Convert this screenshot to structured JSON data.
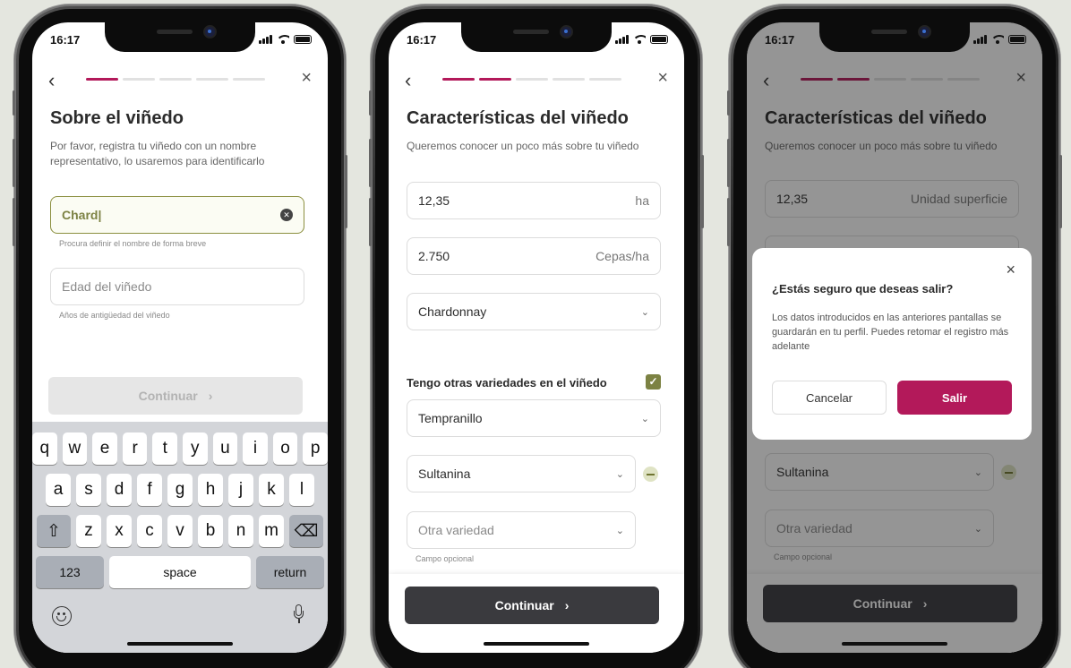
{
  "status": {
    "time": "16:17"
  },
  "screen1": {
    "title": "Sobre el viñedo",
    "subtitle": "Por favor, registra tu viñedo con un nombre representativo, lo usaremos para identificarlo",
    "name_value": "Chard|",
    "name_help": "Procura definir el nombre de forma breve",
    "age_placeholder": "Edad del viñedo",
    "age_help": "Años de antigüedad del viñedo",
    "continue_label": "Continuar",
    "progress_step": 1,
    "keyboard": {
      "row1": [
        "q",
        "w",
        "e",
        "r",
        "t",
        "y",
        "u",
        "i",
        "o",
        "p"
      ],
      "row2": [
        "a",
        "s",
        "d",
        "f",
        "g",
        "h",
        "j",
        "k",
        "l"
      ],
      "row3": [
        "z",
        "x",
        "c",
        "v",
        "b",
        "n",
        "m"
      ],
      "numbers": "123",
      "space": "space",
      "return": "return"
    }
  },
  "screen2": {
    "title": "Características del viñedo",
    "subtitle": "Queremos conocer un poco más sobre tu viñedo",
    "surface_value": "12,35",
    "surface_unit": "ha",
    "density_value": "2.750",
    "density_unit": "Cepas/ha",
    "variety": "Chardonnay",
    "other_varieties_label": "Tengo otras variedades en el viñedo",
    "variety2": "Tempranillo",
    "variety3": "Sultanina",
    "variety4_placeholder": "Otra variedad",
    "optional_help": "Campo opcional",
    "continue_label": "Continuar",
    "progress_step": 2
  },
  "screen3": {
    "title": "Características del viñedo",
    "subtitle": "Queremos conocer un poco más sobre tu viñedo",
    "surface_value": "12,35",
    "surface_unit": "Unidad superficie",
    "variety3": "Sultanina",
    "variety4_placeholder": "Otra variedad",
    "optional_help": "Campo opcional",
    "continue_label": "Continuar",
    "modal": {
      "title": "¿Estás seguro que deseas salir?",
      "body": "Los datos introducidos en las anteriores pantallas se guardarán en tu perfil. Puedes retomar el registro más adelante",
      "cancel": "Cancelar",
      "exit": "Salir"
    }
  },
  "colors": {
    "accent": "#b3195a",
    "olive": "#7c8243",
    "background": "#e4e6df",
    "dark_button": "#3a3a3e"
  }
}
